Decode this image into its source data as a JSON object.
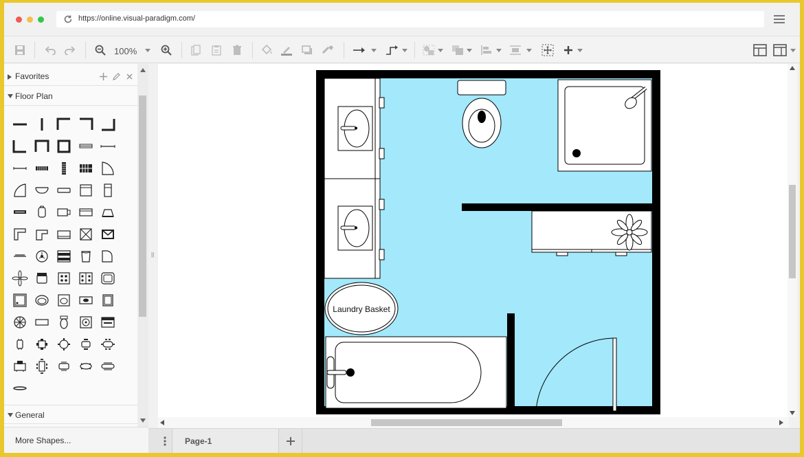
{
  "browser": {
    "url": "https://online.visual-paradigm.com/",
    "dot_colors": [
      "#ee5c54",
      "#f5be4f",
      "#33c748"
    ]
  },
  "toolbar": {
    "zoom": "100%"
  },
  "sidebar": {
    "favorites_label": "Favorites",
    "floor_plan_label": "Floor Plan",
    "general_label": "General",
    "more_shapes_label": "More Shapes..."
  },
  "diagram": {
    "floor_color": "#a3e8fb",
    "wall_color": "#000000",
    "laundry_label": "Laundry Basket"
  },
  "pages": {
    "tabs": [
      "Page-1"
    ]
  }
}
